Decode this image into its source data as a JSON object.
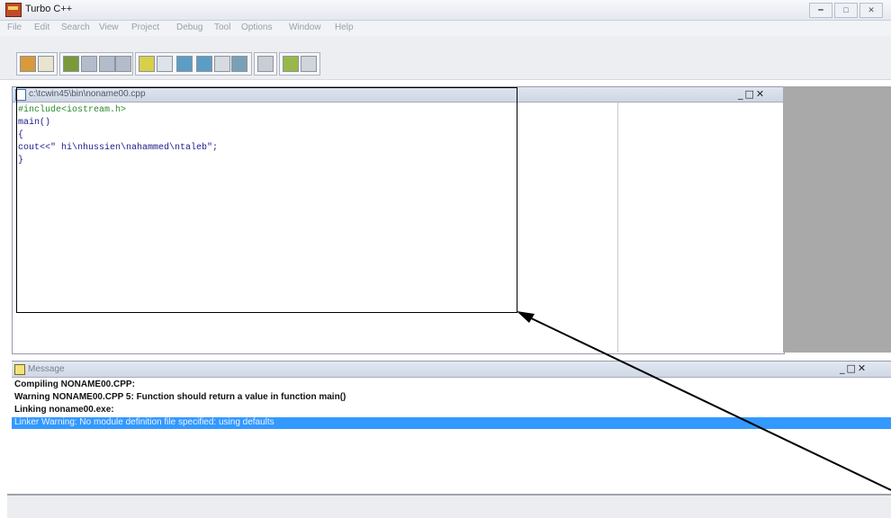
{
  "window": {
    "title": "Turbo C++",
    "controls": [
      "minimize-icon",
      "maximize-icon",
      "close-icon"
    ]
  },
  "menu": {
    "items": [
      "File",
      "Edit",
      "Search",
      "View",
      "Project",
      "Debug",
      "Tool",
      "Options",
      "Window",
      "Help"
    ]
  },
  "editor": {
    "title": "c:\\tcwin45\\bin\\noname00.cpp",
    "code_lines": [
      "#include<iostream.h>",
      "main()",
      "{",
      "cout<<\" hi\\nhussien\\nahammed\\ntaleb\";",
      "}"
    ]
  },
  "message": {
    "title": "Message",
    "lines": [
      "Compiling NONAME00.CPP:",
      "Warning NONAME00.CPP 5: Function should return a value in function main()",
      "Linking noname00.exe:"
    ],
    "selected_line": "Linker Warning: No module definition file specified: using defaults"
  },
  "colors": {
    "selection": "#3399ff",
    "code_text": "#1a1a8c",
    "preprocessor": "#2a8a2a"
  }
}
